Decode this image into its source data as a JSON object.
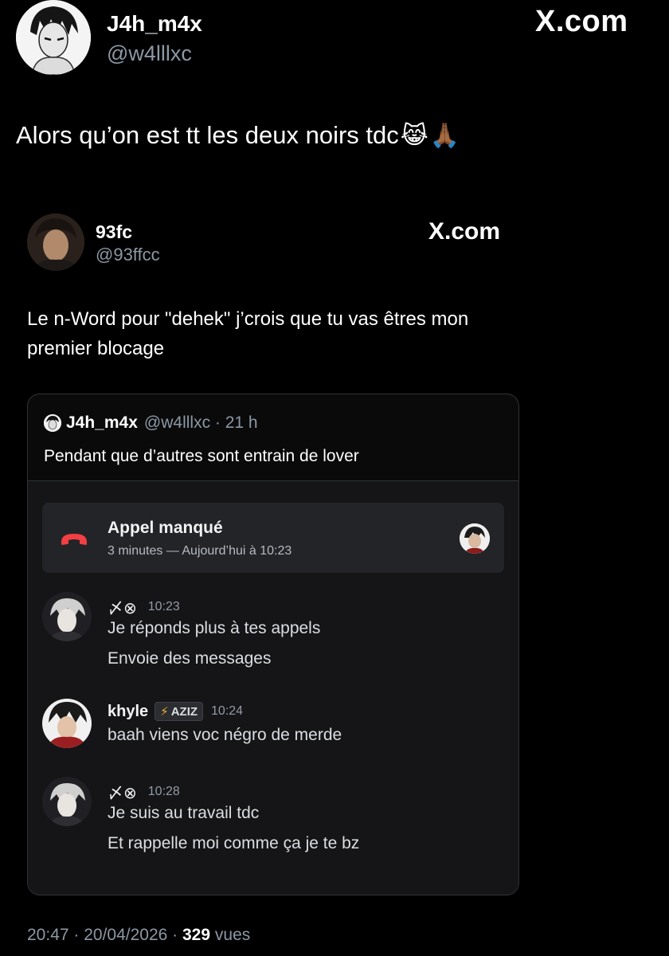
{
  "outer": {
    "name": "J4h_m4x",
    "handle": "@w4lllxc",
    "brand": "X.com",
    "text": "Alors qu’on est tt les deux noirs tdc",
    "emojis": [
      "😹",
      "🙏🏾"
    ]
  },
  "quoted": {
    "name": "93fc",
    "handle": "@93ffcc",
    "brand": "X.com",
    "text": "Le n-Word pour \"dehek\" j’crois que tu vas êtres mon premier blocage"
  },
  "card": {
    "name": "J4h_m4x",
    "handle": "@w4lllxc · 21 h",
    "text": "Pendant que d’autres sont entrain de lover"
  },
  "discord": {
    "call": {
      "title": "Appel manqué",
      "subtitle": "3 minutes — Aujourd’hui à 10:23",
      "icon": "phone-hangup-icon",
      "icon_color": "#f23f43"
    },
    "messages": [
      {
        "user_symbol": "〆⊗",
        "time": "10:23",
        "lines": [
          "Je réponds plus à tes appels",
          "Envoie des messages"
        ]
      },
      {
        "user": "khyle",
        "tag": "AZIZ",
        "tag_icon": "lightning-icon",
        "time": "10:24",
        "lines": [
          "baah viens voc négro de  merde"
        ]
      },
      {
        "user_symbol": "〆⊗",
        "time": "10:28",
        "lines": [
          "Je suis au travail tdc",
          "Et rappelle moi comme ça je te bz"
        ]
      }
    ]
  },
  "footer": {
    "time_date": "20:47 · 20/04/2026 ·",
    "views_count": "329",
    "views_label": "vues"
  },
  "colors": {
    "background": "#000000",
    "text": "#e7e9ea",
    "secondary": "#8b98a5",
    "discord_bg": "#151518",
    "call_box": "#232428"
  }
}
